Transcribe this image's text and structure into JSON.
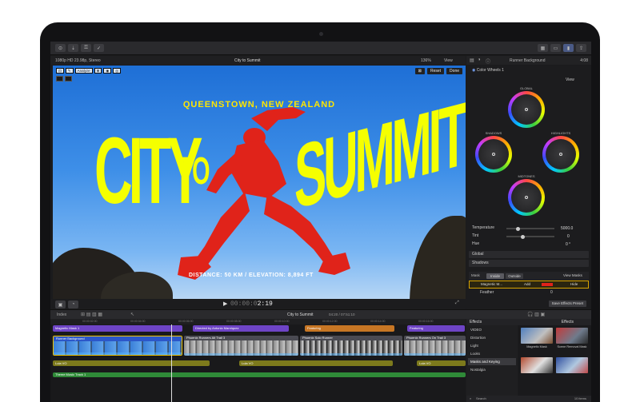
{
  "viewer": {
    "format": "1080p HD 23.98p, Stereo",
    "title": "City to Summit",
    "zoom": "136%",
    "view": "View",
    "overlay_analyze": "Analyze",
    "reset": "Reset",
    "done": "Done",
    "location": "QUEENSTOWN, NEW ZEALAND",
    "headline_1": "CITY",
    "headline_2": "TO",
    "headline_3": "SUMMIT",
    "distance": "DISTANCE: 50 KM / ELEVATION: 8,894 FT",
    "timecode_prefix": "00:00:0",
    "timecode_value": "2:19"
  },
  "inspector": {
    "title": "Runner Background",
    "time": "4:08",
    "effect": "Color Wheels 1",
    "view": "View",
    "wheels": [
      "GLOBAL",
      "SHADOWS",
      "HIGHLIGHTS",
      "MIDTONES"
    ],
    "temperature_label": "Temperature",
    "temperature_value": "5000.0",
    "tint_label": "Tint",
    "tint_value": "0",
    "hue_label": "Hue",
    "hue_value": "0 °",
    "global_section": "Global",
    "shadows_section": "Shadows",
    "mask_label": "Mask",
    "mask_inside": "Inside",
    "mask_outside": "Outside",
    "view_masks": "View Masks",
    "mask_name": "Magnetic M...",
    "mask_add": "Add",
    "mask_hide": "Hide",
    "feather_label": "Feather",
    "feather_value": "0",
    "save_preset": "Save Effects Preset"
  },
  "timeline": {
    "index": "Index",
    "project": "City to Summit",
    "duration": "04:20 / 07:51:10",
    "ruler": [
      "00:00:02:00",
      "00:00:04:00",
      "00:00:06:00",
      "00:00:08:00",
      "00:00:10:00",
      "00:00:12:00",
      "00:00:14:00",
      "00:00:16:00"
    ],
    "clips": {
      "magnetic_mask": "Magnetic Mask 1",
      "directed_by": "Directed by Antonio Manriquez",
      "featuring_1": "Featuring",
      "featuring_2": "Featuring",
      "runner_bg": "Runner Background",
      "phoenix_1": "Phoenix Runners Alt Trail 3",
      "phoenix_2": "Phoenix Solo Runner",
      "phoenix_3": "Phoenix Runners On Trail 3",
      "lula_1": "Lula VO",
      "lula_2": "Lula VO",
      "lula_3": "Lula VO",
      "theme": "Theme Music Track 1"
    }
  },
  "effects": {
    "title": "Effects",
    "title_right": "Effects",
    "categories": [
      "VIDEO",
      "Distortion",
      "Light",
      "Looks",
      "Masks and Keying",
      "Nostalgia"
    ],
    "selected_index": 4,
    "items": [
      "Magnetic Mask",
      "Scene Removal Mask"
    ],
    "search": "Search",
    "count": "10 items"
  }
}
